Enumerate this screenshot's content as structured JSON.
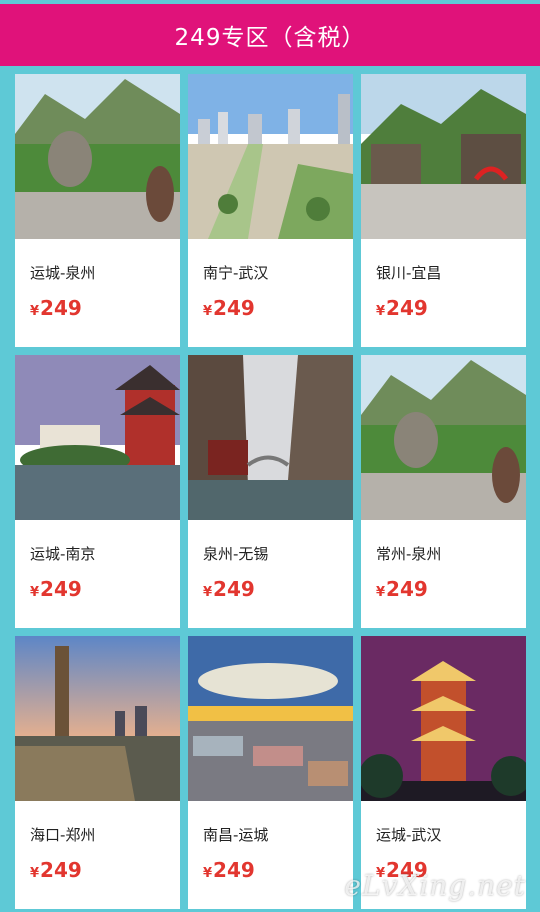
{
  "header": {
    "title": "249专区（含税）"
  },
  "products": [
    {
      "route": "运城-泉州",
      "currency": "¥",
      "price": "249"
    },
    {
      "route": "南宁-武汉",
      "currency": "¥",
      "price": "249"
    },
    {
      "route": "银川-宜昌",
      "currency": "¥",
      "price": "249"
    },
    {
      "route": "运城-南京",
      "currency": "¥",
      "price": "249"
    },
    {
      "route": "泉州-无锡",
      "currency": "¥",
      "price": "249"
    },
    {
      "route": "常州-泉州",
      "currency": "¥",
      "price": "249"
    },
    {
      "route": "海口-郑州",
      "currency": "¥",
      "price": "249"
    },
    {
      "route": "南昌-运城",
      "currency": "¥",
      "price": "249"
    },
    {
      "route": "运城-武汉",
      "currency": "¥",
      "price": "249"
    }
  ],
  "watermark": "eLvXing.net",
  "colors": {
    "header": "#e0127a",
    "background": "#5ec9d6",
    "price": "#e2362f"
  }
}
